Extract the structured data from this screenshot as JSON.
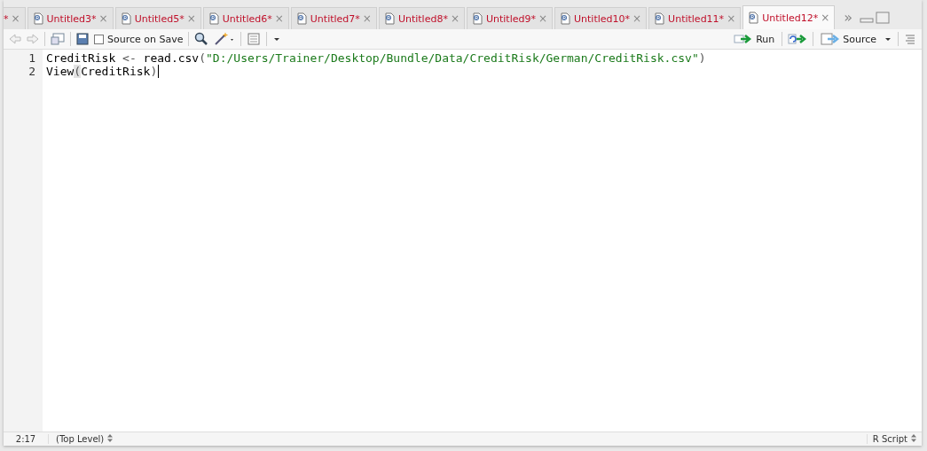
{
  "tabs": [
    {
      "label": "*",
      "selected": false,
      "close": "×"
    },
    {
      "label": "Untitled3*",
      "selected": false,
      "close": "×"
    },
    {
      "label": "Untitled5*",
      "selected": false,
      "close": "×"
    },
    {
      "label": "Untitled6*",
      "selected": false,
      "close": "×"
    },
    {
      "label": "Untitled7*",
      "selected": false,
      "close": "×"
    },
    {
      "label": "Untitled8*",
      "selected": false,
      "close": "×"
    },
    {
      "label": "Untitled9*",
      "selected": false,
      "close": "×"
    },
    {
      "label": "Untitled10*",
      "selected": false,
      "close": "×"
    },
    {
      "label": "Untitled11*",
      "selected": false,
      "close": "×"
    },
    {
      "label": "Untitled12*",
      "selected": true,
      "close": "×"
    }
  ],
  "tab_overflow": "»",
  "toolbar": {
    "source_on_save": {
      "label": "Source on Save",
      "checked": false
    },
    "run": "Run",
    "source": "Source"
  },
  "editor": {
    "lines": [
      {
        "number": "1",
        "tokens": [
          {
            "kind": "identifier",
            "text": "CreditRisk "
          },
          {
            "kind": "operator",
            "text": "<-"
          },
          {
            "kind": "identifier",
            "text": " read.csv"
          },
          {
            "kind": "paren",
            "text": "("
          },
          {
            "kind": "string",
            "text": "\"D:/Users/Trainer/Desktop/Bundle/Data/CreditRisk/German/CreditRisk.csv\""
          },
          {
            "kind": "paren",
            "text": ")"
          }
        ]
      },
      {
        "number": "2",
        "tokens": [
          {
            "kind": "identifier",
            "text": "View"
          },
          {
            "kind": "paren_match",
            "text": "("
          },
          {
            "kind": "identifier",
            "text": "CreditRisk"
          },
          {
            "kind": "paren",
            "text": ")"
          }
        ],
        "cursor": true
      }
    ]
  },
  "status_bar": {
    "position": "2:17",
    "scope": "(Top Level)",
    "file_type": "R Script"
  }
}
